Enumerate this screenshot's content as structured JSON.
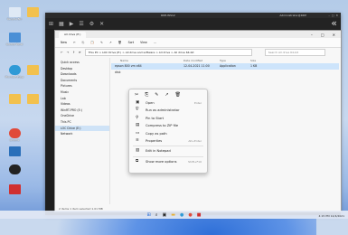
{
  "desktop": {
    "icons": [
      {
        "label": "Recycle Bin",
        "color": "#dfe9f5"
      },
      {
        "label": "",
        "color": "#f2c14e"
      },
      {
        "label": "Control Panel",
        "color": "#4a8fd6"
      },
      {
        "label": "Microsoft Edge",
        "color": "#2f9ad6"
      },
      {
        "label": "",
        "color": "#f2c14e"
      },
      {
        "label": "",
        "color": "#f2c14e"
      },
      {
        "label": "",
        "color": "#f2c14e"
      },
      {
        "label": "Chrome",
        "color": "#e04a3a"
      },
      {
        "label": "",
        "color": "#2a6fb9"
      },
      {
        "label": "",
        "color": "#222222"
      },
      {
        "label": "",
        "color": "#d03030"
      }
    ]
  },
  "remote": {
    "title": "RDP-WS12",
    "user": "Administrator@RDP",
    "chevron": "«"
  },
  "explorer": {
    "tab": "All drive (E:)",
    "commands": [
      "New",
      "Cut",
      "Copy",
      "Paste",
      "Rename",
      "Share",
      "Delete",
      "Sort",
      "View",
      "..."
    ],
    "path": "This PC  >  LOC Drive (E:)  >  All drive and software  >  All drive  >  All drive 64-bit",
    "search_placeholder": "Search All drive 64-bit",
    "sidebar": [
      "Quick access",
      "Desktop",
      "Downloads",
      "Documents",
      "Pictures",
      "Music",
      "Lab",
      "Videos",
      "WinRT-PRO (E:)",
      "OneDrive",
      "This PC",
      "LOC Drive (E:)",
      "Network"
    ],
    "columns": [
      "Name",
      "Date modified",
      "Type",
      "Size"
    ],
    "files": [
      {
        "name": "epson 800 vm x64",
        "date": "12-04-2021 11:00",
        "type": "Application",
        "size": "1 KB"
      },
      {
        "name": "disk",
        "date": "",
        "type": "",
        "size": ""
      }
    ],
    "status": "2 items    1 item selected  1.01 MB"
  },
  "context_menu": {
    "items": [
      {
        "label": "Open",
        "key": "Enter"
      },
      {
        "label": "Run as administrator",
        "key": ""
      },
      {
        "label": "Pin to Start",
        "key": ""
      },
      {
        "label": "Compress to ZIP file",
        "key": ""
      },
      {
        "label": "Copy as path",
        "key": ""
      },
      {
        "label": "Properties",
        "key": "Alt+Enter"
      },
      {
        "label": "Edit in Notepad",
        "key": ""
      },
      {
        "label": "Show more options",
        "key": "Shift+F10"
      }
    ]
  },
  "tray": {
    "time": "4:15 PM",
    "date": "12/4/2021"
  }
}
